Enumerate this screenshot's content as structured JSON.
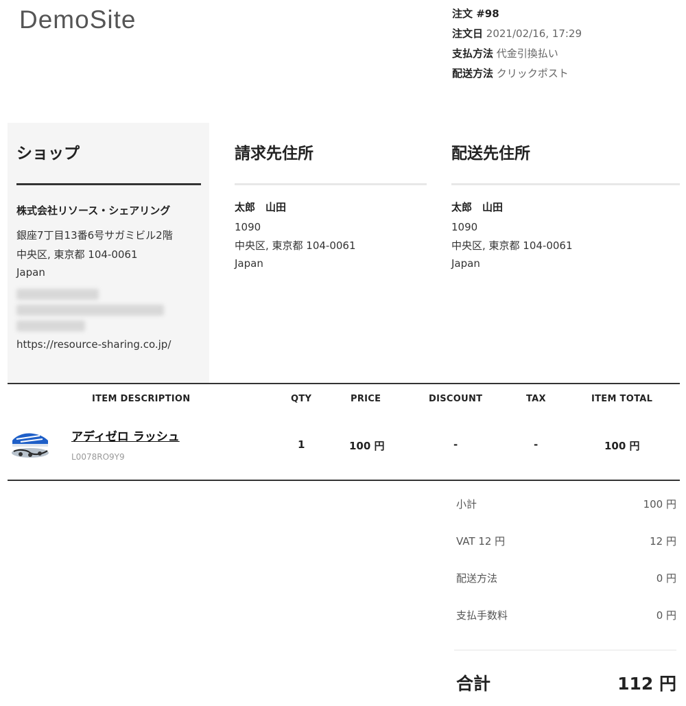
{
  "header": {
    "logo": "DemoSite"
  },
  "order_meta": [
    {
      "label": "注文 #98",
      "value": ""
    },
    {
      "label": "注文日",
      "value": "2021/02/16, 17:29"
    },
    {
      "label": "支払方法",
      "value": "代金引換払い"
    },
    {
      "label": "配送方法",
      "value": "クリックポスト"
    }
  ],
  "shop": {
    "title": "ショップ",
    "name": "株式会社リソース・シェアリング",
    "lines": [
      "銀座7丁目13番6号サガミビル2階",
      "中央区, 東京都 104-0061",
      "Japan"
    ],
    "url": "https://resource-sharing.co.jp/"
  },
  "billing": {
    "title": "請求先住所",
    "name": "太郎　山田",
    "lines": [
      "1090",
      "中央区, 東京都 104-0061",
      "Japan"
    ]
  },
  "shipping": {
    "title": "配送先住所",
    "name": "太郎　山田",
    "lines": [
      "1090",
      "中央区, 東京都 104-0061",
      "Japan"
    ]
  },
  "table": {
    "headers": {
      "description": "ITEM DESCRIPTION",
      "qty": "QTY",
      "price": "PRICE",
      "discount": "DISCOUNT",
      "tax": "TAX",
      "total": "ITEM TOTAL"
    },
    "items": [
      {
        "name": "アディゼロ ラッシュ",
        "sku": "L0078RO9Y9",
        "qty": "1",
        "price": "100 円",
        "discount": "-",
        "tax": "-",
        "total": "100 円"
      }
    ]
  },
  "summary": [
    {
      "label": "小計",
      "value": "100 円"
    },
    {
      "label": "VAT 12 円",
      "value": "12 円"
    },
    {
      "label": "配送方法",
      "value": "0 円"
    },
    {
      "label": "支払手数料",
      "value": "0 円"
    }
  ],
  "grand_total": {
    "label": "合計",
    "value": "112 円"
  }
}
